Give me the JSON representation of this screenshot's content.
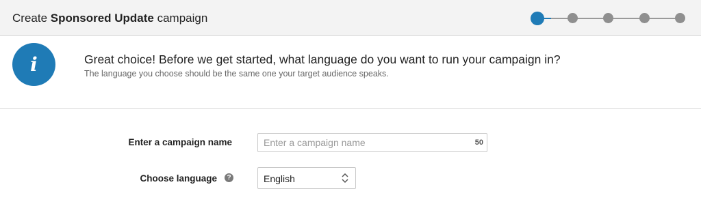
{
  "header": {
    "title_prefix": "Create ",
    "title_bold": "Sponsored Update",
    "title_suffix": " campaign",
    "steps_total": 5,
    "current_step": 1,
    "accent_color": "#1f7bb6"
  },
  "info": {
    "icon": "info-icon",
    "icon_glyph": "i",
    "heading": "Great choice! Before we get started, what language do you want to run your campaign in?",
    "subtext": "The language you choose should be the same one your target audience speaks."
  },
  "form": {
    "campaign_name": {
      "label": "Enter a campaign name",
      "placeholder": "Enter a campaign name",
      "value": "",
      "remaining_chars": "50"
    },
    "language": {
      "label": "Choose language",
      "help_icon": "question-icon",
      "help_glyph": "?",
      "selected": "English"
    }
  }
}
